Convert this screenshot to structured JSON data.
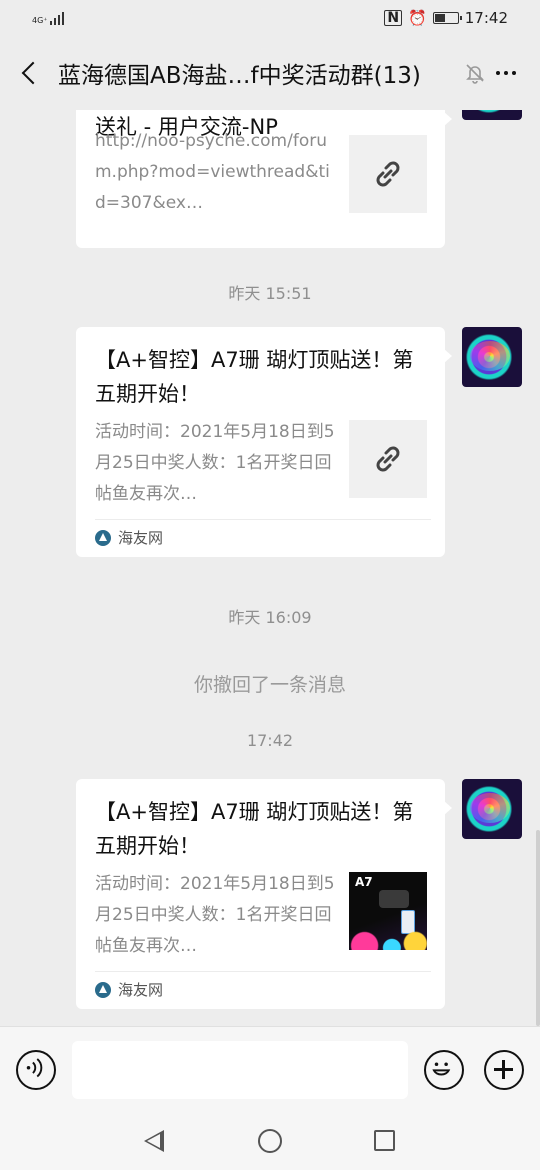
{
  "status_bar": {
    "network": "4G⁺",
    "time": "17:42",
    "battery_level": 0.45
  },
  "header": {
    "title": "蓝海德国AB海盐…f中奖活动群(13)"
  },
  "messages": [
    {
      "title": "送礼 - 用户交流-NP",
      "description": "http://noo-psyche.com/forum.php?mod=viewthread&tid=307&ex…",
      "thumb_icon": "link-icon"
    },
    {
      "timestamp": "昨天 15:51"
    },
    {
      "title": "【A+智控】A7珊 瑚灯顶贴送！第五期开始！",
      "description": "活动时间：2021年5月18日到5月25日中奖人数：1名开奖日回帖鱼友再次…",
      "source": "海友网",
      "thumb_icon": "link-icon"
    },
    {
      "timestamp": "昨天 16:09"
    },
    {
      "system": "你撤回了一条消息"
    },
    {
      "timestamp": "17:42"
    },
    {
      "title": "【A+智控】A7珊 瑚灯顶贴送！第五期开始！",
      "description": "活动时间：2021年5月18日到5月25日中奖人数：1名开奖日回帖鱼友再次…",
      "source": "海友网",
      "thumb_label": "A7"
    }
  ],
  "input": {
    "placeholder": ""
  }
}
